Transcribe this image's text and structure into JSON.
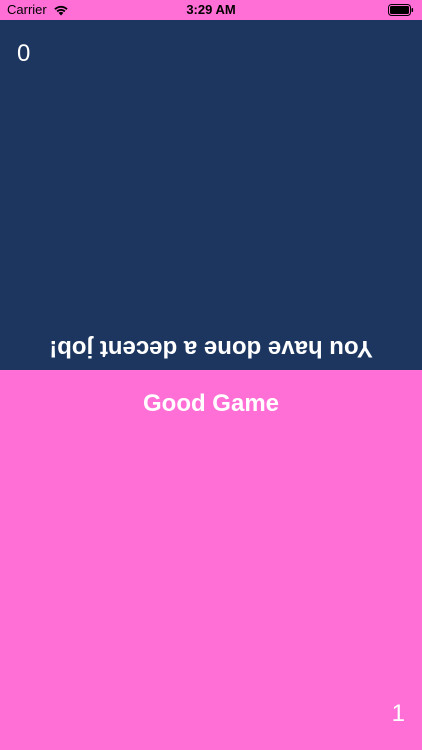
{
  "status_bar": {
    "carrier": "Carrier",
    "time": "3:29 AM",
    "wifi_icon": "wifi-icon",
    "battery_icon": "battery-icon"
  },
  "top_player": {
    "score": "0",
    "message": "You have done a decent job!",
    "background_color": "#1c3660"
  },
  "bottom_player": {
    "score": "1",
    "message": "Good Game",
    "background_color": "#ff6fd6"
  }
}
